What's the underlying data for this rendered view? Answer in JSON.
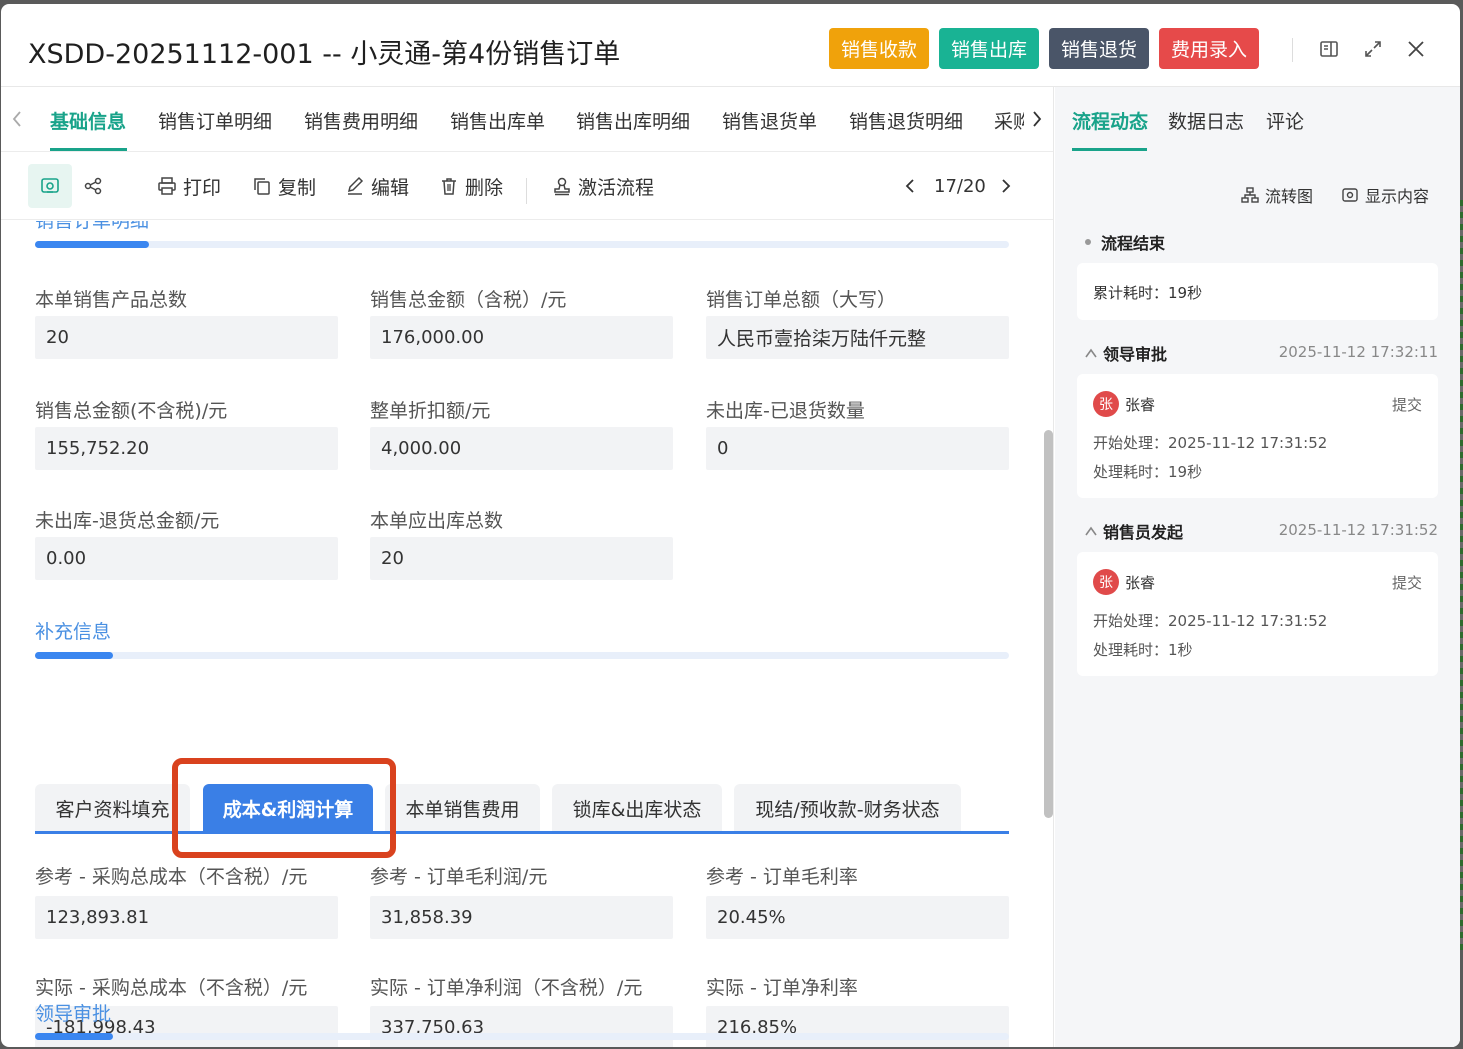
{
  "header": {
    "title": "XSDD-20251112-001 -- 小灵通-第4份销售订单",
    "buttons": [
      {
        "label": "销售收款",
        "color": "#f0a20b"
      },
      {
        "label": "销售出库",
        "color": "#19b394"
      },
      {
        "label": "销售退货",
        "color": "#4a5568"
      },
      {
        "label": "费用录入",
        "color": "#e64a4a"
      }
    ]
  },
  "tabs": [
    "基础信息",
    "销售订单明细",
    "销售费用明细",
    "销售出库单",
    "销售出库明细",
    "销售退货单",
    "销售退货明细",
    "采购"
  ],
  "toolbar": {
    "print": "打印",
    "copy": "复制",
    "edit": "编辑",
    "delete": "删除",
    "activate": "激活流程",
    "pager": "17/20"
  },
  "section_partial": "销售订单明细",
  "summary_fields": [
    {
      "label": "本单销售产品总数",
      "value": "20"
    },
    {
      "label": "销售总金额（含税）/元",
      "value": "176,000.00"
    },
    {
      "label": "销售订单总额（大写）",
      "value": "人民币壹拾柒万陆仟元整"
    },
    {
      "label": "销售总金额(不含税)/元",
      "value": "155,752.20"
    },
    {
      "label": "整单折扣额/元",
      "value": "4,000.00"
    },
    {
      "label": "未出库-已退货数量",
      "value": "0"
    },
    {
      "label": "未出库-退货总金额/元",
      "value": "0.00"
    },
    {
      "label": "本单应出库总数",
      "value": "20"
    }
  ],
  "supplement": {
    "title": "补充信息",
    "subtabs": [
      "客户资料填充",
      "成本&利润计算",
      "本单销售费用",
      "锁库&出库状态",
      "现结/预收款-财务状态"
    ],
    "fields": [
      {
        "label": "参考 - 采购总成本（不含税）/元",
        "value": "123,893.81"
      },
      {
        "label": "参考 - 订单毛利润/元",
        "value": "31,858.39"
      },
      {
        "label": "参考 - 订单毛利率",
        "value": "20.45%"
      },
      {
        "label": "实际 - 采购总成本（不含税）/元",
        "value": "-181,998.43"
      },
      {
        "label": "实际 - 订单净利润（不含税）/元",
        "value": "337,750.63"
      },
      {
        "label": "实际 - 订单净利率",
        "value": "216.85%"
      }
    ]
  },
  "section_leader": "领导审批",
  "right": {
    "tabs": [
      "流程动态",
      "数据日志",
      "评论"
    ],
    "tools": {
      "flow": "流转图",
      "show": "显示内容"
    },
    "end": {
      "title": "流程结束",
      "total": "累计耗时：19秒"
    },
    "nodes": [
      {
        "title": "领导审批",
        "time": "2025-11-12 17:32:11",
        "avatar": "张",
        "user": "张睿",
        "action": "提交",
        "start": "开始处理：2025-11-12 17:31:52",
        "duration": "处理耗时：19秒"
      },
      {
        "title": "销售员发起",
        "time": "2025-11-12 17:31:52",
        "avatar": "张",
        "user": "张睿",
        "action": "提交",
        "start": "开始处理：2025-11-12 17:31:52",
        "duration": "处理耗时：1秒"
      }
    ]
  }
}
